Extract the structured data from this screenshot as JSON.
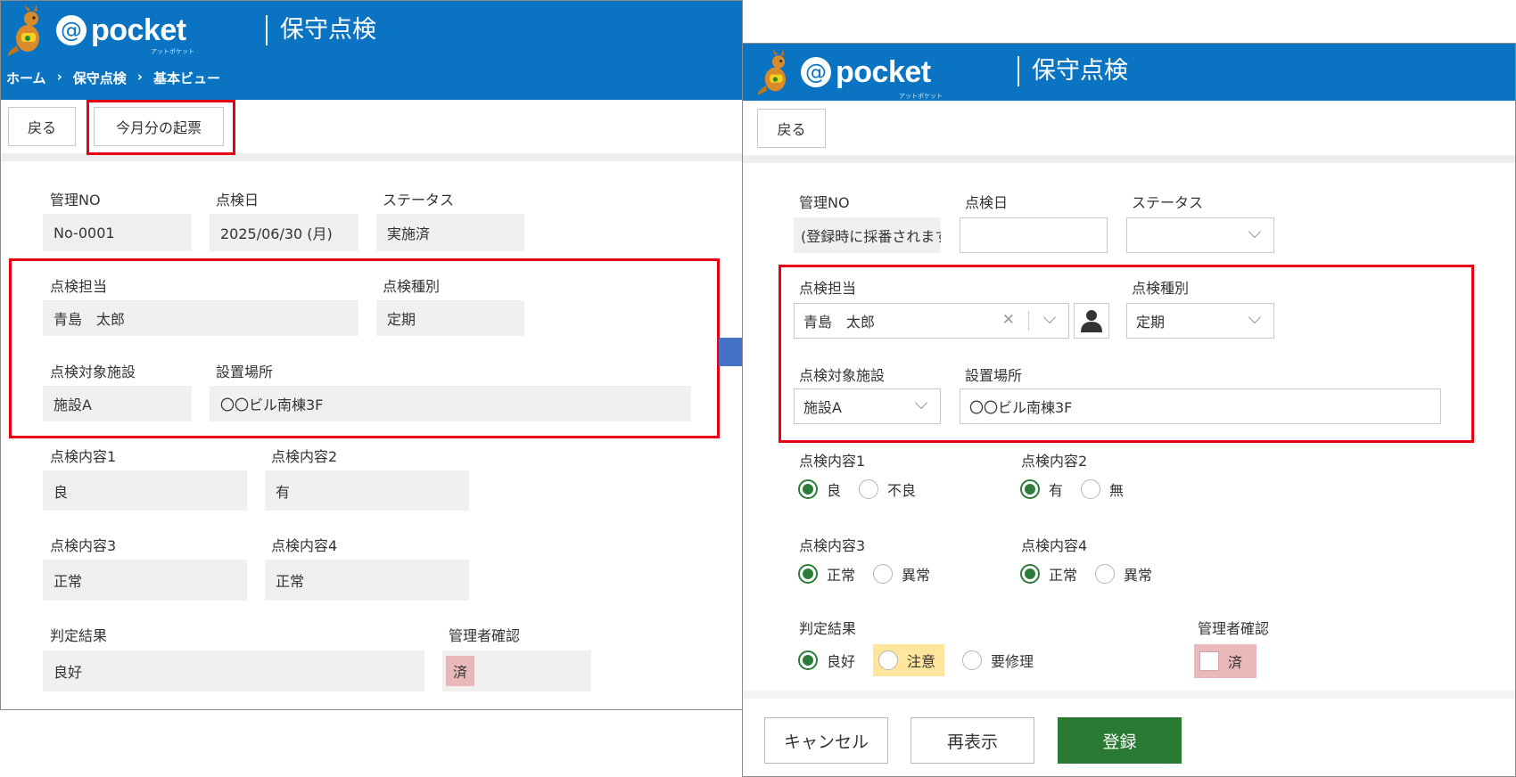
{
  "left": {
    "logo_text": "pocket",
    "logo_sub": "アットポケット",
    "title": "保守点検",
    "breadcrumb": [
      "ホーム",
      "›",
      "保守点検",
      "›",
      "基本ビュー"
    ],
    "back_button": "戻る",
    "create_button": "今月分の起票",
    "fields": {
      "mgmt_no_label": "管理NO",
      "mgmt_no_value": "No-0001",
      "date_label": "点検日",
      "date_value": "2025/06/30 (月)",
      "status_label": "ステータス",
      "status_value": "実施済",
      "person_label": "点検担当",
      "person_value": "青島　太郎",
      "type_label": "点検種別",
      "type_value": "定期",
      "facility_label": "点検対象施設",
      "facility_value": "施設A",
      "location_label": "設置場所",
      "location_value": "〇〇ビル南棟3F",
      "c1_label": "点検内容1",
      "c1_value": "良",
      "c2_label": "点検内容2",
      "c2_value": "有",
      "c3_label": "点検内容3",
      "c3_value": "正常",
      "c4_label": "点検内容4",
      "c4_value": "正常",
      "result_label": "判定結果",
      "result_value": "良好",
      "admin_label": "管理者確認",
      "admin_value": "済"
    }
  },
  "right": {
    "logo_text": "pocket",
    "logo_sub": "アットポケット",
    "title": "保守点検",
    "back_button": "戻る",
    "fields": {
      "mgmt_no_label": "管理NO",
      "mgmt_no_value": "(登録時に採番されます)",
      "date_label": "点検日",
      "date_value": "",
      "status_label": "ステータス",
      "status_value": "",
      "person_label": "点検担当",
      "person_value": "青島　太郎",
      "type_label": "点検種別",
      "type_value": "定期",
      "facility_label": "点検対象施設",
      "facility_value": "施設A",
      "location_label": "設置場所",
      "location_value": "〇〇ビル南棟3F",
      "c1_label": "点検内容1",
      "c1_opt1": "良",
      "c1_opt2": "不良",
      "c2_label": "点検内容2",
      "c2_opt1": "有",
      "c2_opt2": "無",
      "c3_label": "点検内容3",
      "c3_opt1": "正常",
      "c3_opt2": "異常",
      "c4_label": "点検内容4",
      "c4_opt1": "正常",
      "c4_opt2": "異常",
      "result_label": "判定結果",
      "result_opt1": "良好",
      "result_opt2": "注意",
      "result_opt3": "要修理",
      "admin_label": "管理者確認",
      "admin_check_label": "済"
    },
    "cancel_button": "キャンセル",
    "redisplay_button": "再表示",
    "register_button": "登録"
  },
  "colors": {
    "header_blue": "#0a74c2",
    "highlight_red": "#e60012",
    "arrow_blue": "#4472c4",
    "register_green": "#2b7a34",
    "radio_green": "#2d7d3a"
  }
}
